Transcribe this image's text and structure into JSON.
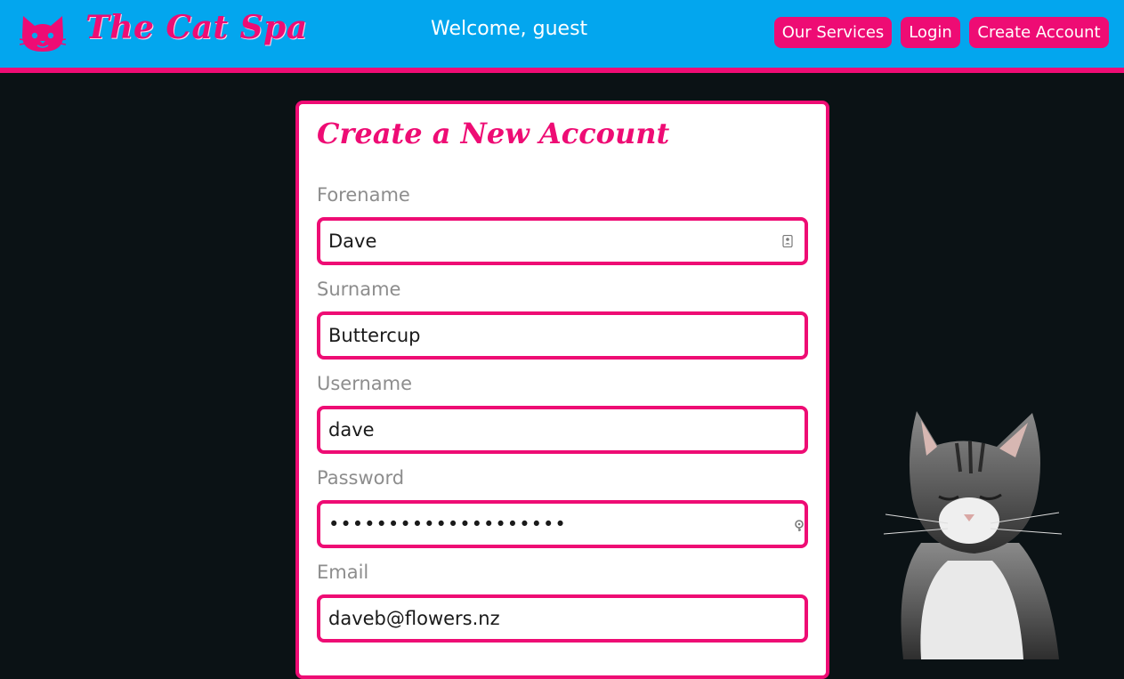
{
  "header": {
    "brand": "The Cat Spa",
    "welcome": "Welcome, guest",
    "nav": {
      "services": "Our Services",
      "login": "Login",
      "create_account": "Create Account"
    },
    "logo_icon": "cat-face-icon"
  },
  "colors": {
    "header_bg": "#03a6ee",
    "accent": "#ee0c74",
    "page_bg": "#0b1215",
    "label": "#8d8d8d"
  },
  "form": {
    "title": "Create a New Account",
    "fields": [
      {
        "label": "Forename",
        "value": "Dave",
        "icon": "contact-card-icon"
      },
      {
        "label": "Surname",
        "value": "Buttercup"
      },
      {
        "label": "Username",
        "value": "dave"
      },
      {
        "label": "Password",
        "value": "••••••••••••••••••••",
        "icon": "password-key-icon"
      },
      {
        "label": "Email",
        "value": "daveb@flowers.nz"
      }
    ]
  }
}
